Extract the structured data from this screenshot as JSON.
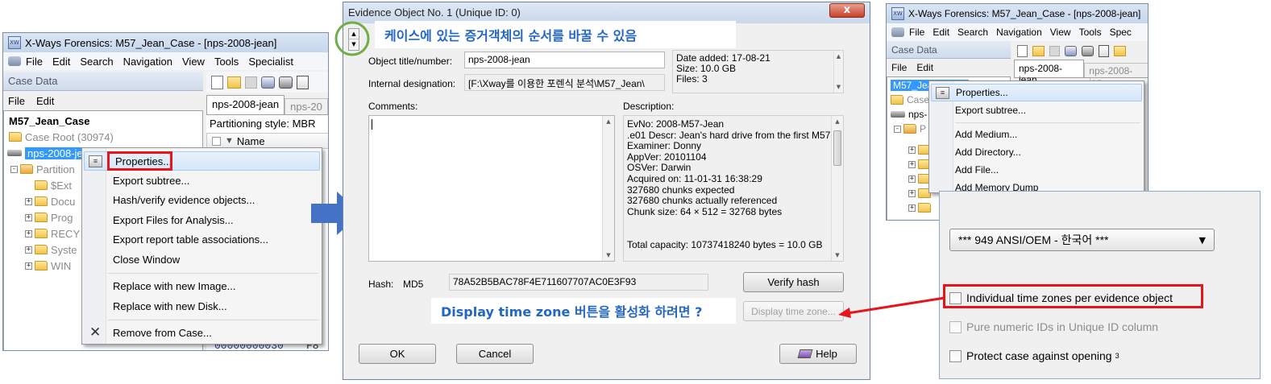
{
  "left_window": {
    "title": "X-Ways Forensics: M57_Jean_Case - [nps-2008-jean]",
    "menu": [
      "File",
      "Edit",
      "Search",
      "Navigation",
      "View",
      "Tools",
      "Specialist"
    ],
    "case_data_header": "Case Data",
    "case_menu": [
      "File",
      "Edit"
    ],
    "case_name": "M57_Jean_Case",
    "case_root": "Case Root (30974)",
    "evidence_item": "nps-2008-je",
    "tree_items": [
      "Partition",
      "$Ext",
      "Docu",
      "Prog",
      "RECY",
      "Syste",
      "WIN"
    ],
    "tab_active": "nps-2008-jean",
    "tab_inactive": "nps-20",
    "partitioning": "Partitioning style: MBR",
    "col_name": "Name",
    "hex_fragment": "00000000030",
    "hex_fragment2": "F8"
  },
  "left_context_menu": {
    "items": [
      "Properties...",
      "Export subtree...",
      "Hash/verify evidence objects...",
      "Export Files for Analysis...",
      "Export report table associations...",
      "Close Window",
      "Replace with new Image...",
      "Replace with new Disk...",
      "Remove from Case..."
    ]
  },
  "dialog": {
    "title": "Evidence Object No. 1 (Unique ID: 0)",
    "close_label": "x",
    "label_title": "Object title/number:",
    "value_title": "nps-2008-jean",
    "label_internal": "Internal designation:",
    "value_internal": "[F:\\Xway를 이용한 포렌식 분석\\M57_Jean\\",
    "date_added": "Date added: 17-08-21",
    "size": "Size: 10.0 GB",
    "files": "Files: 3",
    "label_comments": "Comments:",
    "label_description": "Description:",
    "description_lines": [
      "EvNo: 2008-M57-Jean",
      ".e01 Descr: Jean's hard drive from the first M57 pro",
      "Examiner: Donny",
      "AppVer: 20101104",
      "OSVer: Darwin",
      "Acquired on: 11-01-31 16:38:29",
      "327680 chunks expected",
      "327680 chunks actually referenced",
      "Chunk size: 64 × 512 = 32768 bytes",
      "",
      "",
      "Total capacity: 10737418240 bytes = 10.0 GB"
    ],
    "hash_label": "Hash:",
    "hash_type": "MD5",
    "hash_value": "78A52B5BAC78F4E711607707AC0E3F93",
    "verify_hash": "Verify hash",
    "display_time_zone": "Display time zone...",
    "ok": "OK",
    "cancel": "Cancel",
    "help": "Help"
  },
  "annotations": {
    "reorder_note": "케이스에 있는 증거객체의 순서를 바꿀 수 있음",
    "timezone_note": "Display time zone 버튼을 활성화 하려면 ?"
  },
  "right_window": {
    "title": "X-Ways Forensics: M57_Jean_Case - [nps-2008-jean]",
    "menu": [
      "File",
      "Edit",
      "Search",
      "Navigation",
      "View",
      "Tools",
      "Spec"
    ],
    "case_data_header": "Case Data",
    "case_menu": [
      "File",
      "Edit"
    ],
    "case_name": "M57_Jean_Case",
    "case_root_fragment": "Case",
    "evidence_fragment": "nps-",
    "partition_fragment": "P",
    "tab_active": "nps-2008-jean",
    "tab_inactive": "nps-2008-jea"
  },
  "right_context_menu": {
    "items": [
      "Properties...",
      "Export subtree...",
      "Add Medium...",
      "Add Directory...",
      "Add File...",
      "Add Memory Dump"
    ]
  },
  "options_panel": {
    "codepage": "*** 949  ANSI/OEM - 한국어 ***",
    "opt_timezones": "Individual time zones per evidence object",
    "opt_numeric_ids": "Pure numeric IDs in Unique ID column",
    "opt_protect": "Protect case against opening",
    "opt_protect_sup": "3"
  },
  "colors": {
    "highlight_red": "#e8141c",
    "annotation_blue": "#2467c2",
    "arrow_blue": "#4472c4",
    "circle_green": "#70ad47",
    "selection_blue": "#3399ff"
  }
}
